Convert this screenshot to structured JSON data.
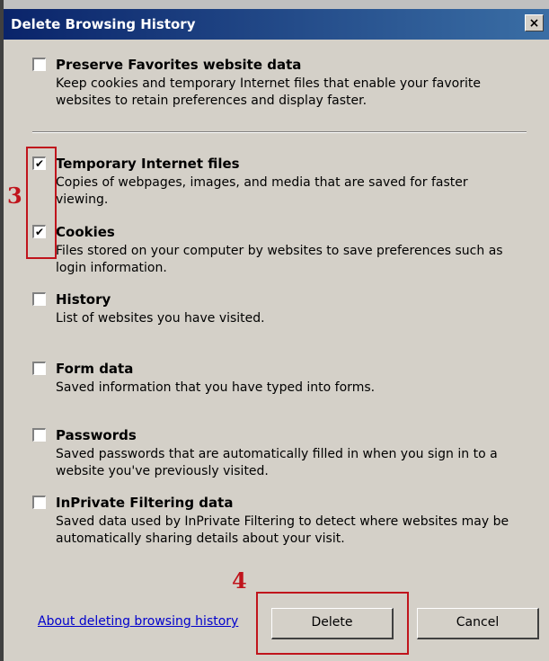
{
  "dialog": {
    "title": "Delete Browsing History",
    "close_glyph": "×"
  },
  "options": [
    {
      "label": "Preserve Favorites website data",
      "description": "Keep cookies and temporary Internet files that enable your favorite websites to retain preferences and display faster.",
      "checked": false
    },
    {
      "label": "Temporary Internet files",
      "description": "Copies of webpages, images, and media that are saved for faster viewing.",
      "checked": true
    },
    {
      "label": "Cookies",
      "description": "Files stored on your computer by websites to save preferences such as login information.",
      "checked": true
    },
    {
      "label": "History",
      "description": "List of websites you have visited.",
      "checked": false
    },
    {
      "label": "Form data",
      "description": "Saved information that you have typed into forms.",
      "checked": false
    },
    {
      "label": "Passwords",
      "description": "Saved passwords that are automatically filled in when you sign in to a website you've previously visited.",
      "checked": false
    },
    {
      "label": "InPrivate Filtering data",
      "description": "Saved data used by InPrivate Filtering to detect where websites may be automatically sharing details about your visit.",
      "checked": false
    }
  ],
  "checkmark_glyph": "✔",
  "footer": {
    "link_text": "About deleting browsing history",
    "delete_label": "Delete",
    "cancel_label": "Cancel"
  },
  "annotations": {
    "step3": "3",
    "step4": "4"
  },
  "colors": {
    "dialog_bg": "#d4d0c8",
    "titlebar_start": "#0a246a",
    "titlebar_end": "#3a6ea5",
    "annotation": "#c0141c",
    "link": "#0000cc"
  }
}
